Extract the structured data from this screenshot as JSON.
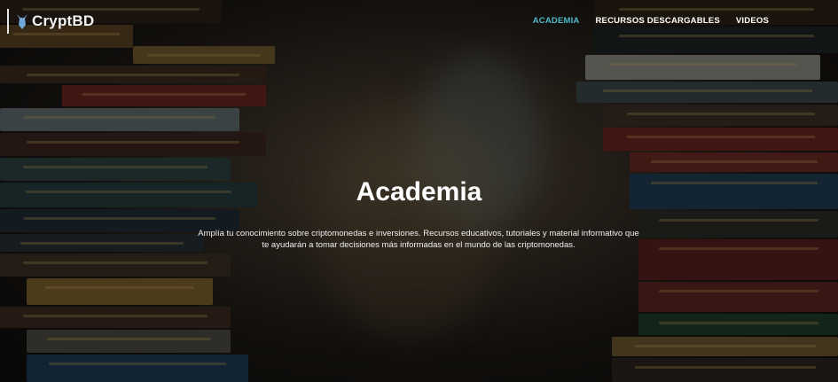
{
  "brand": {
    "name": "CryptBD"
  },
  "nav": {
    "items": [
      {
        "label": "ACADEMIA"
      },
      {
        "label": "RECURSOS DESCARGABLES"
      },
      {
        "label": "VIDEOS"
      }
    ]
  },
  "hero": {
    "title": "Academia",
    "description": "Amplía tu conocimiento sobre criptomonedas e inversiones. Recursos educativos, tutoriales y material informativo que te ayudarán a tomar decisiones más informadas en el mundo de las criptomonedas."
  },
  "colors": {
    "accent": "#4fb9c9",
    "text": "#ffffff"
  },
  "background": {
    "subject": "book-stacks"
  }
}
